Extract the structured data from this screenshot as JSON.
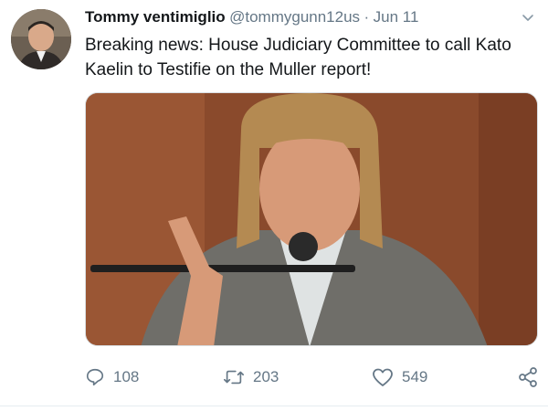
{
  "tweet": {
    "display_name": "Tommy ventimiglio",
    "handle": "@tommygunn12us",
    "separator": "·",
    "date": "Jun 11",
    "text": "Breaking news: House Judiciary Committee to call Kato Kaelin to  Testifie on the Muller report!",
    "menu_icon": "chevron-down-icon"
  },
  "actions": {
    "reply": {
      "icon": "reply-icon",
      "count": "108"
    },
    "retweet": {
      "icon": "retweet-icon",
      "count": "203"
    },
    "like": {
      "icon": "heart-icon",
      "count": "549"
    },
    "share": {
      "icon": "share-icon"
    }
  },
  "colors": {
    "name": "#14171a",
    "secondary": "#657786",
    "divider": "#e6ecf0"
  }
}
